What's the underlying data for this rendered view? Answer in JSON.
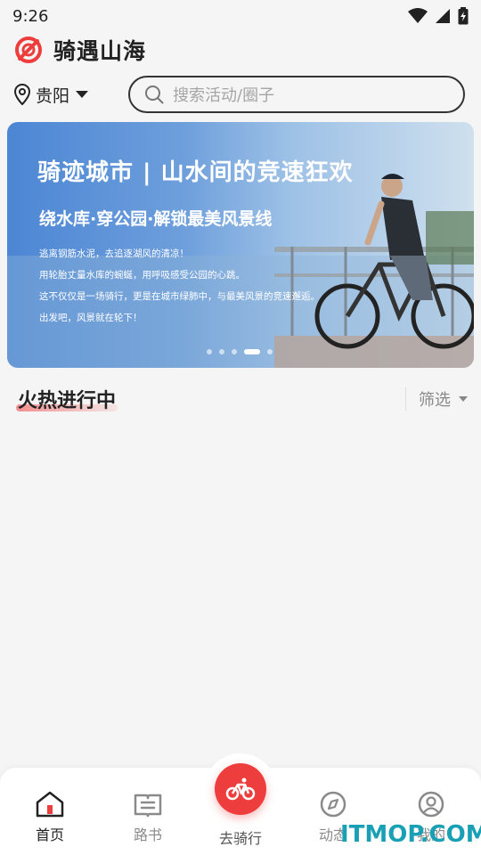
{
  "status_bar": {
    "time": "9:26"
  },
  "app": {
    "title": "骑遇山海",
    "brand_color": "#ee3d3d"
  },
  "location": {
    "city": "贵阳"
  },
  "search": {
    "placeholder": "搜索活动/圈子"
  },
  "banner": {
    "title": "骑迹城市 | 山水间的竞速狂欢",
    "subtitle": "绕水库·穿公园·解锁最美风景线",
    "lines": [
      "逃离钢筋水泥，去追逐湖风的清凉！",
      "用轮胎丈量水库的蜿蜒，用呼吸感受公园的心跳。",
      "这不仅仅是一场骑行，更是在城市绿肺中，与最美风景的竞速邂逅。",
      "出发吧，风景就在轮下！"
    ],
    "dots_total": 5,
    "active_dot": 4
  },
  "section": {
    "title": "火热进行中",
    "filter_label": "筛选"
  },
  "bottom_nav": {
    "items": [
      {
        "label": "首页",
        "icon": "home-icon",
        "active": true
      },
      {
        "label": "路书",
        "icon": "route-book-icon",
        "active": false
      },
      {
        "label": "去骑行",
        "icon": "bicycle-icon",
        "active": false
      },
      {
        "label": "动态",
        "icon": "compass-icon",
        "active": false
      },
      {
        "label": "我的",
        "icon": "profile-icon",
        "active": false
      }
    ]
  },
  "watermark": "ITMOP.COM"
}
